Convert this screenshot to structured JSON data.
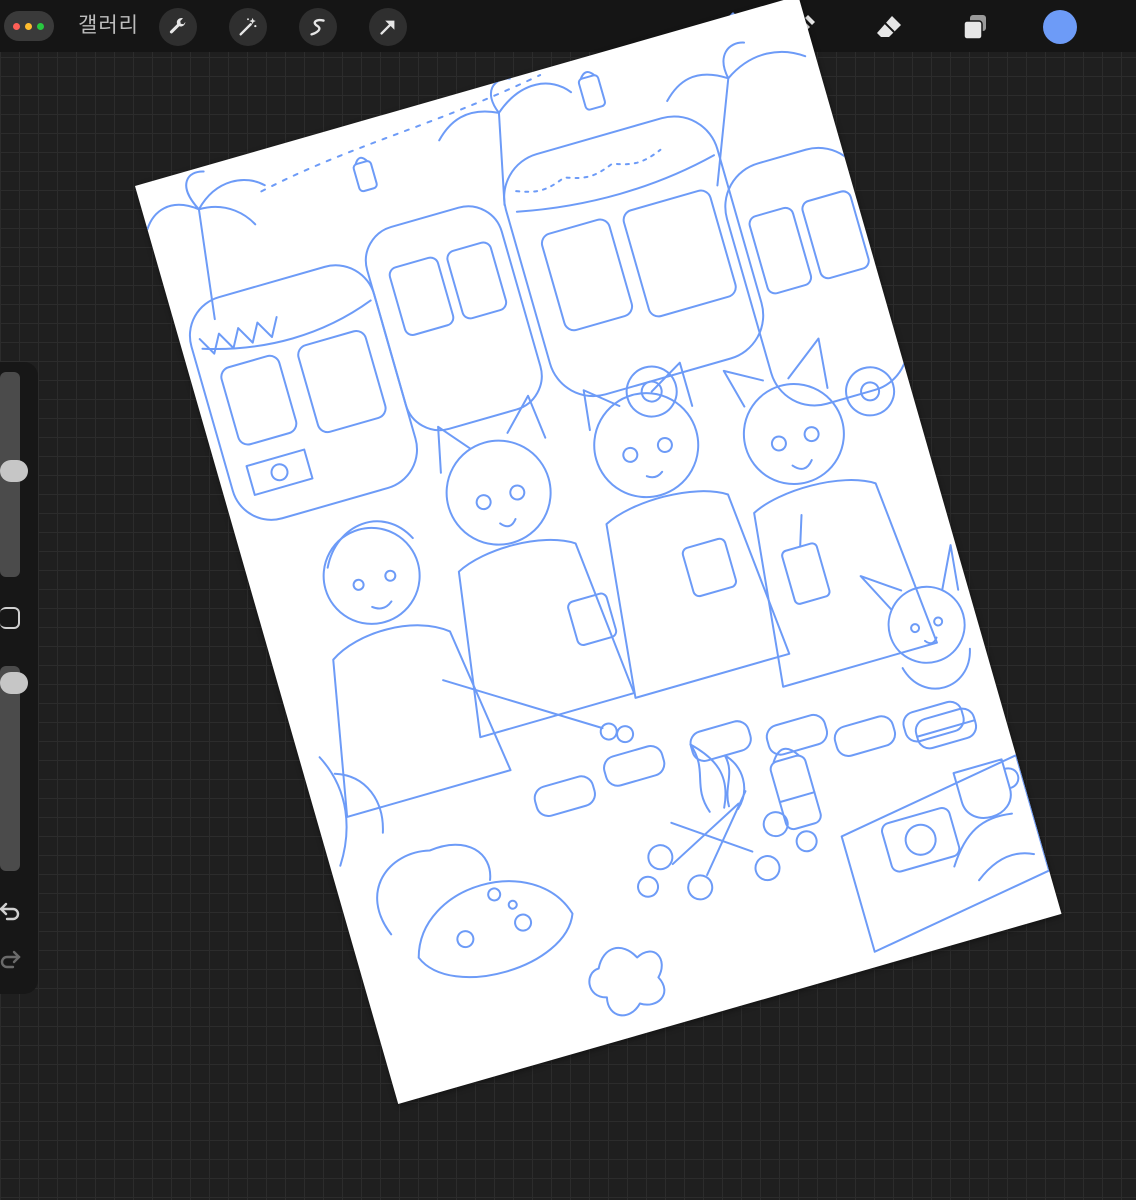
{
  "topbar": {
    "gallery_label": "갤러리",
    "left_tools": [
      "wrench-icon",
      "magic-wand-icon",
      "selection-icon",
      "transform-arrow-icon"
    ],
    "right_tools": [
      "brush-icon",
      "smudge-icon",
      "eraser-icon",
      "layers-icon"
    ],
    "active_tool": "brush-icon",
    "current_color": "#6d9bf7"
  },
  "sidebar": {
    "controls": [
      "brush-size-slider",
      "modify-button",
      "opacity-slider",
      "undo-icon",
      "redo-icon"
    ]
  },
  "canvas": {
    "stroke_color": "#6d9bf7",
    "paper_color": "#ffffff",
    "rotation_deg": -16
  }
}
